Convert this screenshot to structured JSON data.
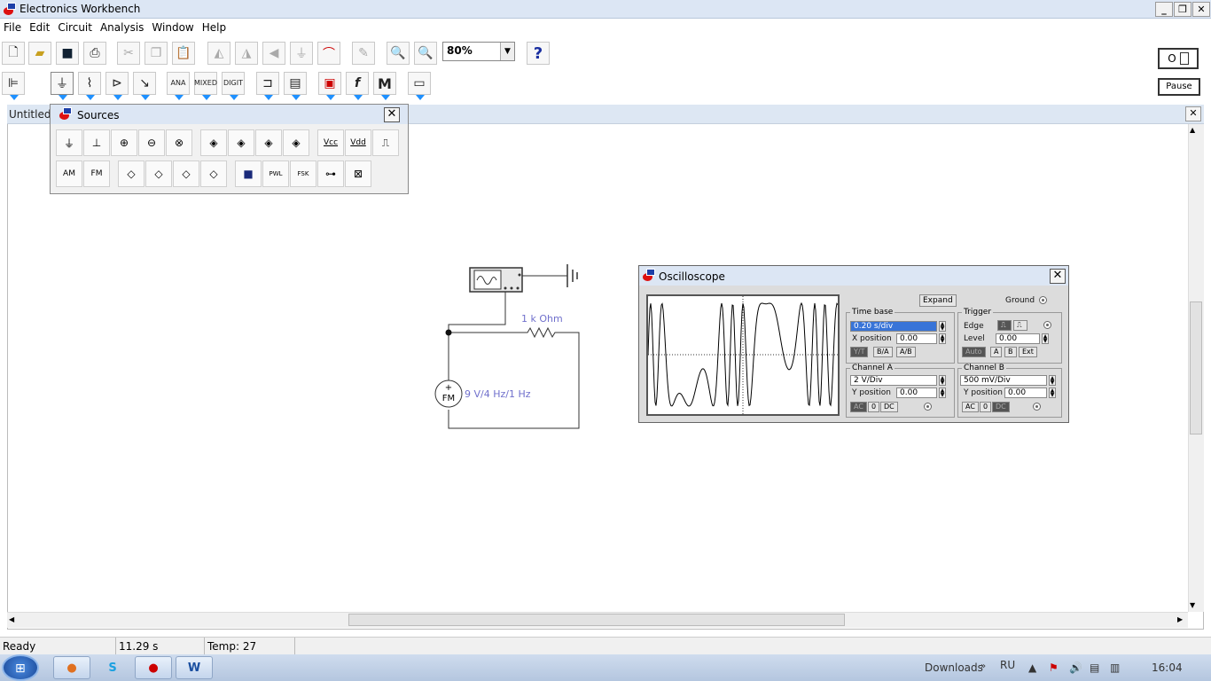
{
  "window": {
    "title": "Electronics Workbench"
  },
  "menu": [
    "File",
    "Edit",
    "Circuit",
    "Analysis",
    "Window",
    "Help"
  ],
  "toolbar": {
    "zoom_value": "80%",
    "help_label": "?",
    "pause_label": "Pause",
    "power_label": "O"
  },
  "parts_bar": {
    "ana_label": "ANA",
    "mixed_label": "MIXED",
    "digit_label": "DIGIT",
    "m_label": "M"
  },
  "document": {
    "title": "Untitled"
  },
  "sources": {
    "title": "Sources",
    "vcc_label": "Vcc",
    "vdd_label": "Vdd",
    "am_label": "AM",
    "fm_label": "FM",
    "pwl_label": "PWL",
    "fsk_label": "FSK"
  },
  "circuit": {
    "resistor_label": "1 k Ohm",
    "source_label": "9 V/4 Hz/1 Hz",
    "source_symbol": "FM",
    "plus": "+"
  },
  "oscilloscope": {
    "title": "Oscilloscope",
    "expand_label": "Expand",
    "ground_label": "Ground",
    "timebase": {
      "title": "Time base",
      "value": "0.20 s/div",
      "xpos_label": "X position",
      "xpos_value": "0.00",
      "modes": [
        "Y/T",
        "B/A",
        "A/B"
      ]
    },
    "trigger": {
      "title": "Trigger",
      "edge_label": "Edge",
      "level_label": "Level",
      "level_value": "0.00",
      "sources": [
        "Auto",
        "A",
        "B",
        "Ext"
      ]
    },
    "channel_a": {
      "title": "Channel A",
      "value": "2  V/Div",
      "ypos_label": "Y position",
      "ypos_value": "0.00",
      "coupling": [
        "AC",
        "0",
        "DC"
      ]
    },
    "channel_b": {
      "title": "Channel B",
      "value": "500 mV/Div",
      "ypos_label": "Y position",
      "ypos_value": "0.00",
      "coupling": [
        "AC",
        "0",
        "DC"
      ]
    }
  },
  "status": {
    "ready": "Ready",
    "time": "11.29 s",
    "temp": "Temp:  27"
  },
  "taskbar": {
    "downloads": "Downloads",
    "lang": "RU",
    "clock": "16:04"
  }
}
